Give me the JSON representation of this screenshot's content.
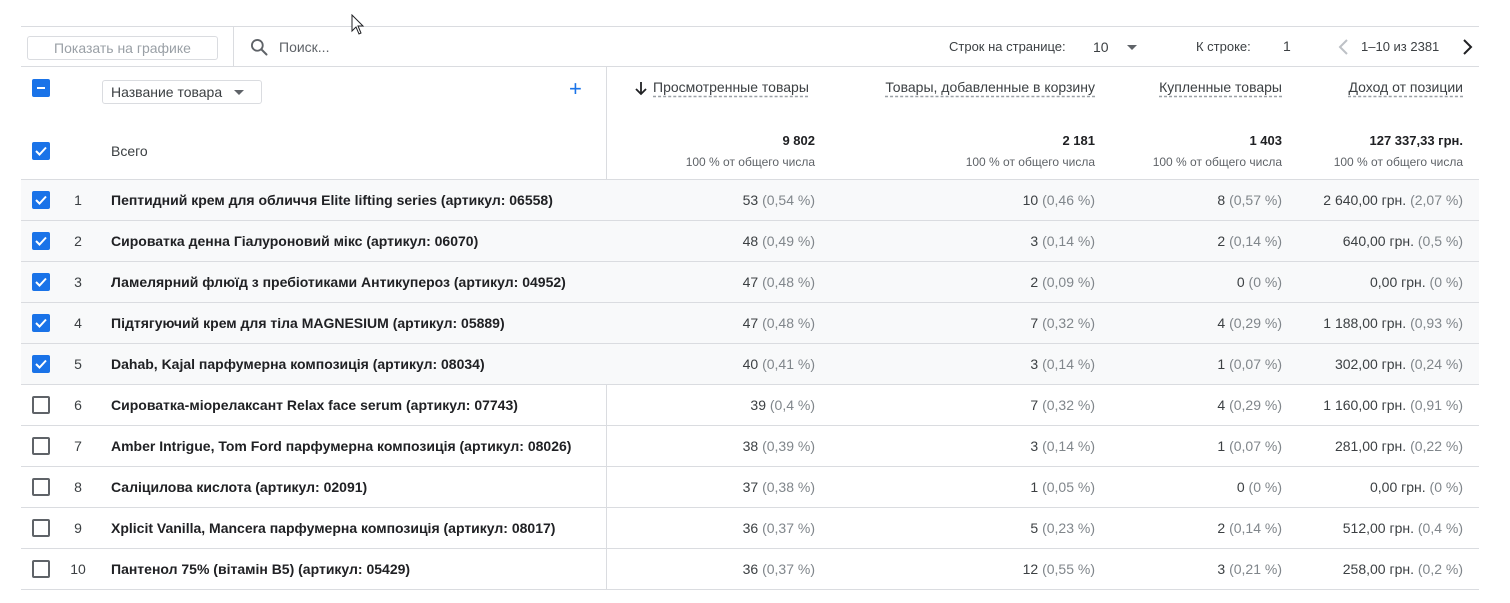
{
  "toolbar": {
    "chart_button_label": "Показать на графике",
    "search_placeholder": "Поиск...",
    "rows_per_page_label": "Строк на странице:",
    "rows_per_page_value": "10",
    "goto_row_label": "К строке:",
    "goto_row_value": "1",
    "page_range": "1–10 из 2381"
  },
  "header": {
    "dimension_label": "Название товара",
    "add_label": "+",
    "totals_label": "Всего",
    "metrics": [
      {
        "label": "Просмотренные товары",
        "total": "9 802",
        "sub": "100 % от общего числа"
      },
      {
        "label": "Товары, добавленные в корзину",
        "total": "2 181",
        "sub": "100 % от общего числа"
      },
      {
        "label": "Купленные товары",
        "total": "1 403",
        "sub": "100 % от общего числа"
      },
      {
        "label": "Доход от позиции",
        "total": "127 337,33 грн.",
        "sub": "100 % от общего числа"
      }
    ]
  },
  "rows": [
    {
      "idx": "1",
      "checked": true,
      "name": "Пептидний крем для обличчя Elite lifting series (артикул: 06558)",
      "views": "53",
      "views_pct": "(0,54 %)",
      "cart": "10",
      "cart_pct": "(0,46 %)",
      "bought": "8",
      "bought_pct": "(0,57 %)",
      "revenue": "2 640,00 грн.",
      "revenue_pct": "(2,07 %)"
    },
    {
      "idx": "2",
      "checked": true,
      "name": "Сироватка денна Гіалуроновий мікс (артикул: 06070)",
      "views": "48",
      "views_pct": "(0,49 %)",
      "cart": "3",
      "cart_pct": "(0,14 %)",
      "bought": "2",
      "bought_pct": "(0,14 %)",
      "revenue": "640,00 грн.",
      "revenue_pct": "(0,5 %)"
    },
    {
      "idx": "3",
      "checked": true,
      "name": "Ламелярний флюїд з пребіотиками Антикупероз (артикул: 04952)",
      "views": "47",
      "views_pct": "(0,48 %)",
      "cart": "2",
      "cart_pct": "(0,09 %)",
      "bought": "0",
      "bought_pct": "(0 %)",
      "revenue": "0,00 грн.",
      "revenue_pct": "(0 %)"
    },
    {
      "idx": "4",
      "checked": true,
      "name": "Підтягуючий крем для тіла MAGNESIUM (артикул: 05889)",
      "views": "47",
      "views_pct": "(0,48 %)",
      "cart": "7",
      "cart_pct": "(0,32 %)",
      "bought": "4",
      "bought_pct": "(0,29 %)",
      "revenue": "1 188,00 грн.",
      "revenue_pct": "(0,93 %)"
    },
    {
      "idx": "5",
      "checked": true,
      "name": "Dahab, Kajal парфумерна композиція (артикул: 08034)",
      "views": "40",
      "views_pct": "(0,41 %)",
      "cart": "3",
      "cart_pct": "(0,14 %)",
      "bought": "1",
      "bought_pct": "(0,07 %)",
      "revenue": "302,00 грн.",
      "revenue_pct": "(0,24 %)"
    },
    {
      "idx": "6",
      "checked": false,
      "name": "Сироватка-міорелаксант Relax face serum (артикул: 07743)",
      "views": "39",
      "views_pct": "(0,4 %)",
      "cart": "7",
      "cart_pct": "(0,32 %)",
      "bought": "4",
      "bought_pct": "(0,29 %)",
      "revenue": "1 160,00 грн.",
      "revenue_pct": "(0,91 %)"
    },
    {
      "idx": "7",
      "checked": false,
      "name": "Amber Intrigue, Tom Ford парфумерна композиція (артикул: 08026)",
      "views": "38",
      "views_pct": "(0,39 %)",
      "cart": "3",
      "cart_pct": "(0,14 %)",
      "bought": "1",
      "bought_pct": "(0,07 %)",
      "revenue": "281,00 грн.",
      "revenue_pct": "(0,22 %)"
    },
    {
      "idx": "8",
      "checked": false,
      "name": "Саліцилова кислота (артикул: 02091)",
      "views": "37",
      "views_pct": "(0,38 %)",
      "cart": "1",
      "cart_pct": "(0,05 %)",
      "bought": "0",
      "bought_pct": "(0 %)",
      "revenue": "0,00 грн.",
      "revenue_pct": "(0 %)"
    },
    {
      "idx": "9",
      "checked": false,
      "name": "Xplicit Vanilla, Mancera парфумерна композиція (артикул: 08017)",
      "views": "36",
      "views_pct": "(0,37 %)",
      "cart": "5",
      "cart_pct": "(0,23 %)",
      "bought": "2",
      "bought_pct": "(0,14 %)",
      "revenue": "512,00 грн.",
      "revenue_pct": "(0,4 %)"
    },
    {
      "idx": "10",
      "checked": false,
      "name": "Пантенол 75% (вітамін B5) (артикул: 05429)",
      "views": "36",
      "views_pct": "(0,37 %)",
      "cart": "12",
      "cart_pct": "(0,55 %)",
      "bought": "3",
      "bought_pct": "(0,21 %)",
      "revenue": "258,00 грн.",
      "revenue_pct": "(0,2 %)"
    }
  ],
  "colors": {
    "accent": "#1a73e8",
    "border": "#dadce0",
    "row_shade": "#f8f9fa"
  }
}
